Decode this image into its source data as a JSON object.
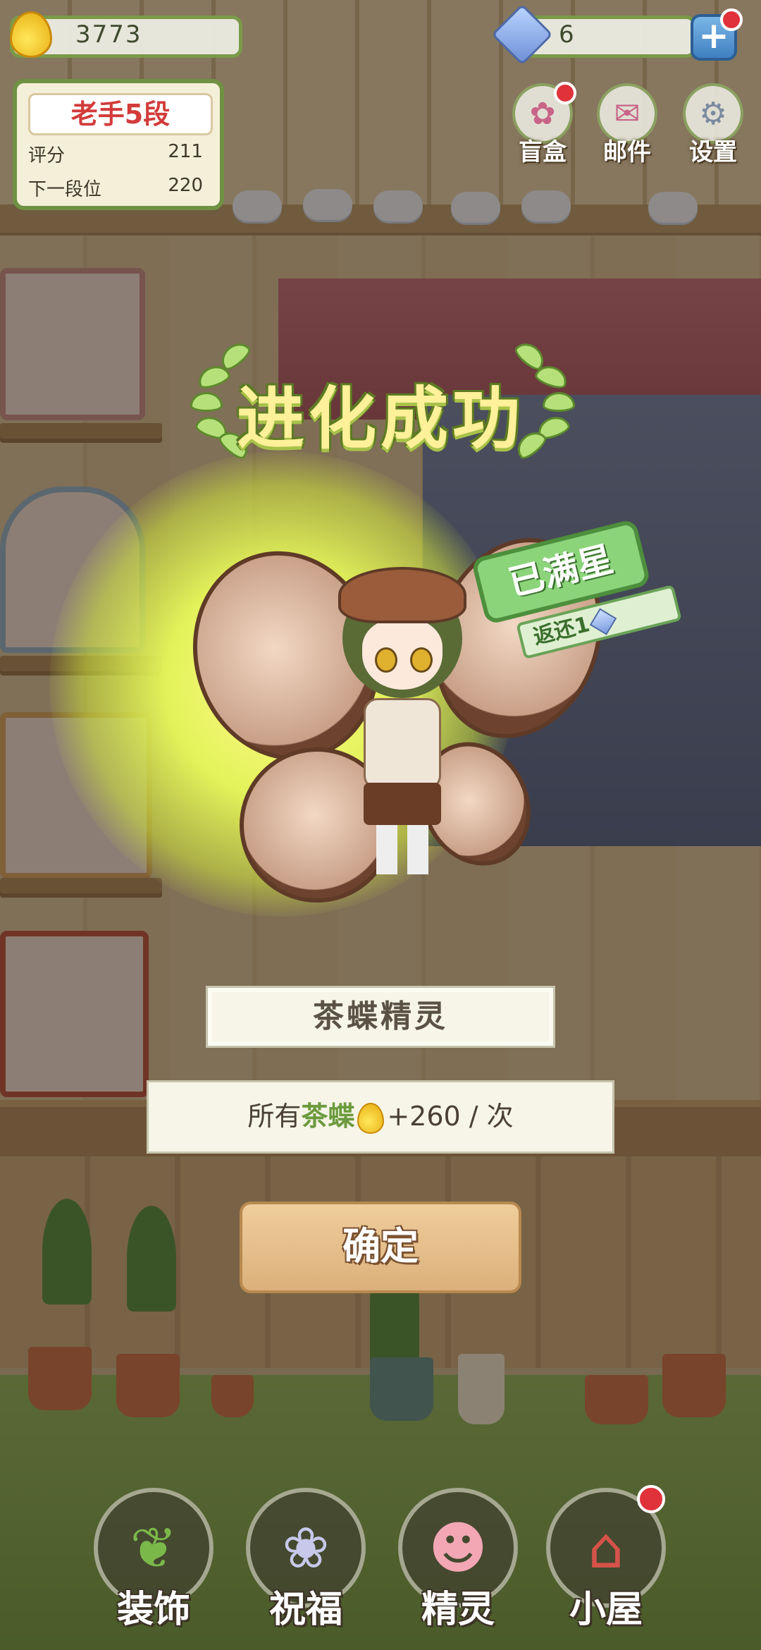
{
  "hud": {
    "drops": "3773",
    "gems": "6",
    "plus_label": "+"
  },
  "rank": {
    "title": "老手5段",
    "score_label": "评分",
    "score_value": "211",
    "next_label": "下一段位",
    "next_value": "220"
  },
  "top_menu": [
    {
      "label": "盲盒",
      "icon": "blind-box-icon",
      "badge": true
    },
    {
      "label": "邮件",
      "icon": "mail-icon",
      "badge": false
    },
    {
      "label": "设置",
      "icon": "gear-icon",
      "badge": false
    }
  ],
  "modal": {
    "title": "进化成功",
    "stamp_text": "已满星",
    "stamp_sub": "返还1",
    "fairy_name": "茶蝶精灵",
    "effect_prefix": "所有",
    "effect_highlight": "茶蝶",
    "effect_suffix": "+260 / 次",
    "confirm_label": "确定"
  },
  "bottom_nav": [
    {
      "label": "装饰",
      "icon": "plant-icon",
      "badge": false
    },
    {
      "label": "祝福",
      "icon": "blessing-icon",
      "badge": false
    },
    {
      "label": "精灵",
      "icon": "fairy-icon",
      "badge": false
    },
    {
      "label": "小屋",
      "icon": "house-icon",
      "badge": true
    }
  ],
  "colors": {
    "accent_green": "#6c9a3e",
    "rank_red": "#d33b3b",
    "badge_red": "#e0323a"
  }
}
